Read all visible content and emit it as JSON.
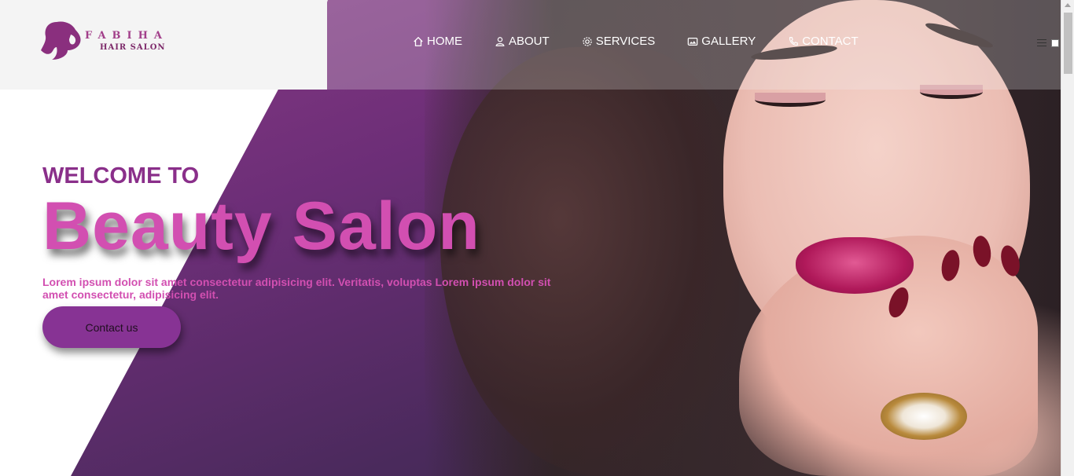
{
  "brand": {
    "name": "FABIHA",
    "tagline": "HAIR SALON",
    "logo_icon": "woman-silhouette-icon",
    "accent_color": "#873394",
    "pink_color": "#d24fb1"
  },
  "nav": {
    "items": [
      {
        "label": "HOME",
        "icon": "home-icon"
      },
      {
        "label": "ABOUT",
        "icon": "user-icon"
      },
      {
        "label": "SERVICES",
        "icon": "gear-icon"
      },
      {
        "label": "GALLERY",
        "icon": "image-icon"
      },
      {
        "label": "CONTACT",
        "icon": "phone-icon"
      }
    ],
    "menu_icon": "hamburger-icon"
  },
  "hero": {
    "welcome": "WELCOME TO",
    "title": "Beauty Salon",
    "lead": "Lorem ipsum dolor sit amet consectetur adipisicing elit. Veritatis, voluptas Lorem ipsum dolor sit amet consectetur, adipisicing elit.",
    "cta_label": "Contact us"
  }
}
